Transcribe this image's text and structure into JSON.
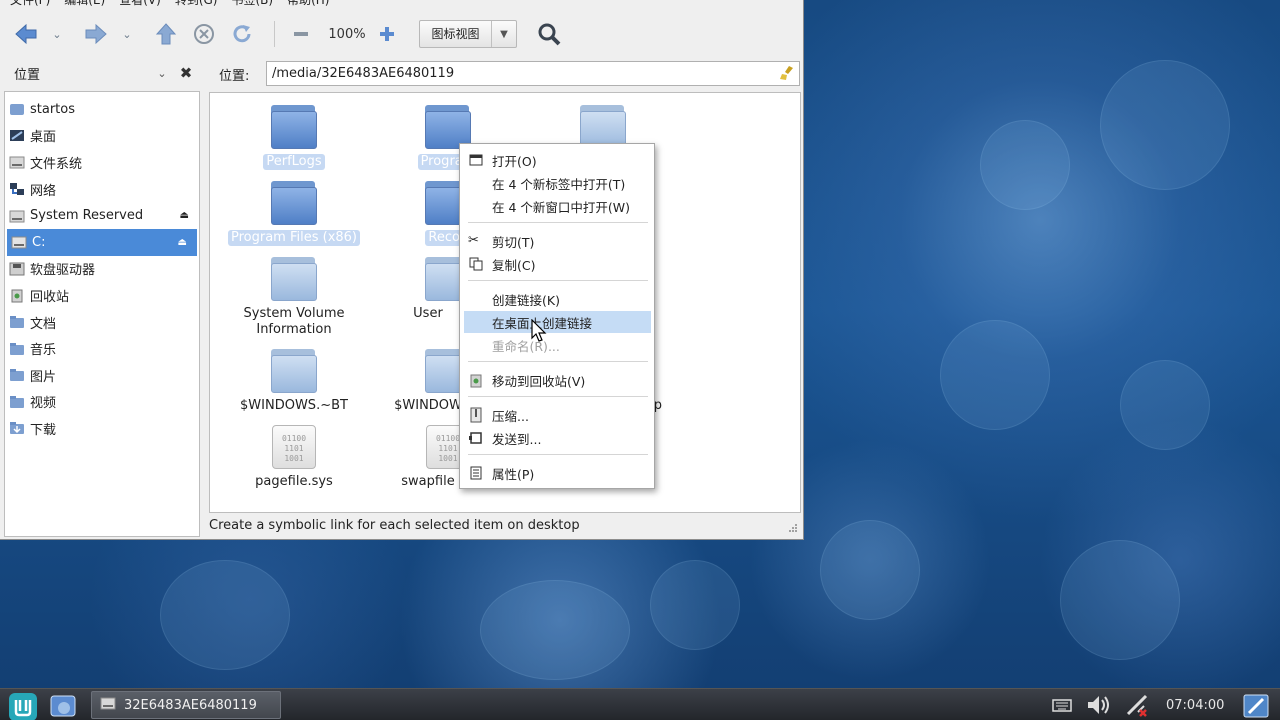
{
  "menubar": {
    "items": [
      "文件(F)",
      "编辑(E)",
      "查看(V)",
      "转到(G)",
      "书签(B)",
      "帮助(H)"
    ]
  },
  "toolbar": {
    "zoom_level": "100%",
    "view_mode": "图标视图"
  },
  "sidepane": {
    "title": "位置",
    "items": [
      {
        "label": "startos",
        "icon": "home-folder-icon"
      },
      {
        "label": "桌面",
        "icon": "desktop-icon"
      },
      {
        "label": "文件系统",
        "icon": "drive-icon"
      },
      {
        "label": "网络",
        "icon": "network-icon"
      },
      {
        "label": "System Reserved",
        "icon": "drive-icon",
        "eject": true
      },
      {
        "label": "C:",
        "icon": "drive-icon",
        "eject": true,
        "selected": true
      },
      {
        "label": "软盘驱动器",
        "icon": "floppy-icon"
      },
      {
        "label": "回收站",
        "icon": "trash-icon"
      },
      {
        "label": "文档",
        "icon": "documents-icon"
      },
      {
        "label": "音乐",
        "icon": "music-icon"
      },
      {
        "label": "图片",
        "icon": "pictures-icon"
      },
      {
        "label": "视频",
        "icon": "videos-icon"
      },
      {
        "label": "下载",
        "icon": "downloads-icon"
      }
    ]
  },
  "location": {
    "label": "位置:",
    "path": "/media/32E6483AE6480119"
  },
  "files": [
    {
      "name": "PerfLogs",
      "type": "folder",
      "selected": true
    },
    {
      "name": "Program",
      "type": "folder",
      "selected": true
    },
    {
      "name": "",
      "type": "folder-dim",
      "selected": false
    },
    {
      "name": "Program Files (x86)",
      "type": "folder",
      "selected": true
    },
    {
      "name": "Recov",
      "type": "folder",
      "selected": true
    },
    {
      "name": "System Volume Information",
      "type": "folder-dim",
      "selected": false
    },
    {
      "name": "User",
      "type": "folder-dim",
      "selected": false
    },
    {
      "name": "$WINDOWS.~BT",
      "type": "folder-dim",
      "selected": false
    },
    {
      "name": "$WINDOW",
      "type": "folder-dim",
      "selected": false
    },
    {
      "name": "p",
      "type": "folder-dim",
      "selected": false
    },
    {
      "name": "pagefile.sys",
      "type": "sysfile",
      "selected": false
    },
    {
      "name": "swapfile",
      "type": "sysfile",
      "selected": false
    }
  ],
  "sysfile_glyph": [
    "01100",
    "1101",
    "1001"
  ],
  "context_menu": {
    "items": [
      {
        "label": "打开(O)",
        "icon": "open-icon"
      },
      {
        "label": "在 4 个新标签中打开(T)"
      },
      {
        "label": "在 4 个新窗口中打开(W)"
      },
      {
        "label": "剪切(T)",
        "icon": "scissors-icon"
      },
      {
        "label": "复制(C)",
        "icon": "copy-icon"
      },
      {
        "label": "创建链接(K)"
      },
      {
        "label": "在桌面上创建链接",
        "highlighted": true
      },
      {
        "label": "重命名(R)...",
        "disabled": true
      },
      {
        "label": "移动到回收站(V)",
        "icon": "trash-icon"
      },
      {
        "label": "压缩...",
        "icon": "archive-icon"
      },
      {
        "label": "发送到...",
        "icon": "send-icon"
      },
      {
        "label": "属性(P)",
        "icon": "properties-icon"
      }
    ]
  },
  "statusbar": {
    "text": "Create a symbolic link for each selected item on desktop"
  },
  "taskbar": {
    "task_title": "32E6483AE6480119",
    "clock": "07:04:00"
  },
  "colors": {
    "accent": "#4a8ad8",
    "highlight": "#c5dcf5",
    "folder": "#5b8bd0"
  }
}
